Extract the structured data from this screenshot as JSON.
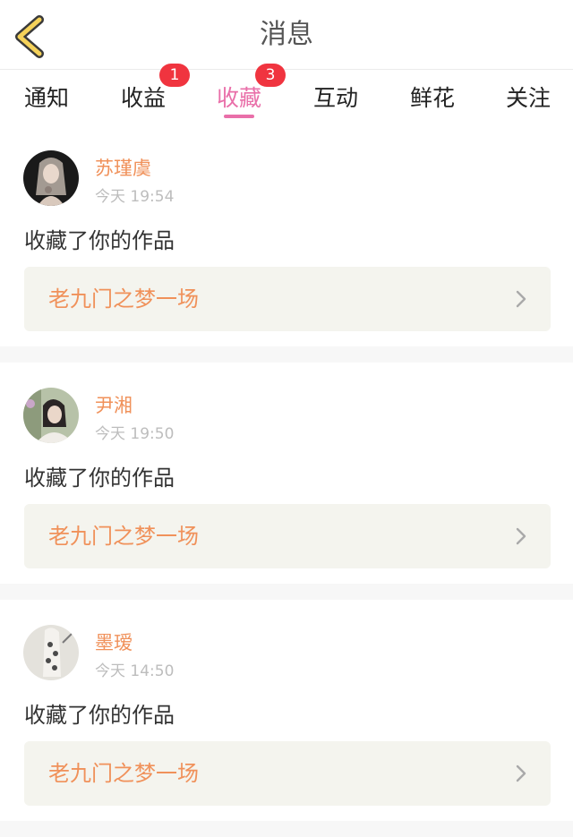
{
  "header": {
    "title": "消息"
  },
  "tabs": [
    {
      "label": "通知",
      "active": false
    },
    {
      "label": "收益",
      "active": false,
      "badge": "1"
    },
    {
      "label": "收藏",
      "active": true,
      "badge": "3"
    },
    {
      "label": "互动",
      "active": false
    },
    {
      "label": "鲜花",
      "active": false
    },
    {
      "label": "关注",
      "active": false
    }
  ],
  "feed": [
    {
      "username": "苏瑾虞",
      "time": "今天 19:54",
      "action": "收藏了你的作品",
      "work_title": "老九门之梦一场"
    },
    {
      "username": "尹湘",
      "time": "今天 19:50",
      "action": "收藏了你的作品",
      "work_title": "老九门之梦一场"
    },
    {
      "username": "墨瑷",
      "time": "今天 14:50",
      "action": "收藏了你的作品",
      "work_title": "老九门之梦一场"
    }
  ],
  "colors": {
    "accent": "#e96fa9",
    "badge": "#f0343f",
    "name": "#f0915a",
    "work_bg": "#f4f4ee"
  },
  "icons": {
    "back": "chevron-left-icon",
    "row": "chevron-right-icon"
  }
}
